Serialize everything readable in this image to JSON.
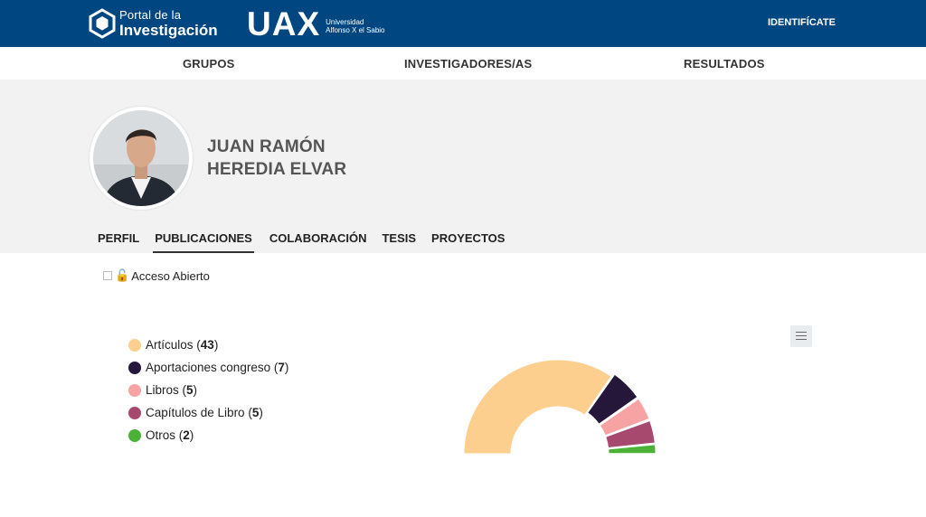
{
  "header": {
    "portal_line1": "Portal de la",
    "portal_line2": "Investigación",
    "uax_logo": "UAX",
    "uax_line1": "Universidad",
    "uax_line2": "Alfonso X el Sabio",
    "identify": "IDENTIFÍCATE",
    "bg_color": "#004680"
  },
  "nav": {
    "items": [
      "GRUPOS",
      "INVESTIGADORES/AS",
      "RESULTADOS"
    ]
  },
  "profile": {
    "name_line1": "JUAN RAMÓN",
    "name_line2": "HEREDIA ELVAR"
  },
  "tabs": [
    "PERFIL",
    "PUBLICACIONES",
    "COLABORACIÓN",
    "TESIS",
    "PROYECTOS"
  ],
  "active_tab": "PUBLICACIONES",
  "filter": {
    "open_access_label": "Acceso Abierto",
    "icon": "open-access-lock-icon"
  },
  "chart_data": {
    "type": "pie",
    "variant": "semi-donut",
    "legend_position": "left",
    "series": [
      {
        "name": "Artículos",
        "value": 43,
        "color": "#fccf8f"
      },
      {
        "name": "Aportaciones congreso",
        "value": 7,
        "color": "#24173a"
      },
      {
        "name": "Libros",
        "value": 5,
        "color": "#f8a3a3"
      },
      {
        "name": "Capítulos de Libro",
        "value": 5,
        "color": "#a7496e"
      },
      {
        "name": "Otros",
        "value": 2,
        "color": "#4cb137"
      }
    ]
  },
  "chart_menu_icon": "hamburger-menu-icon"
}
